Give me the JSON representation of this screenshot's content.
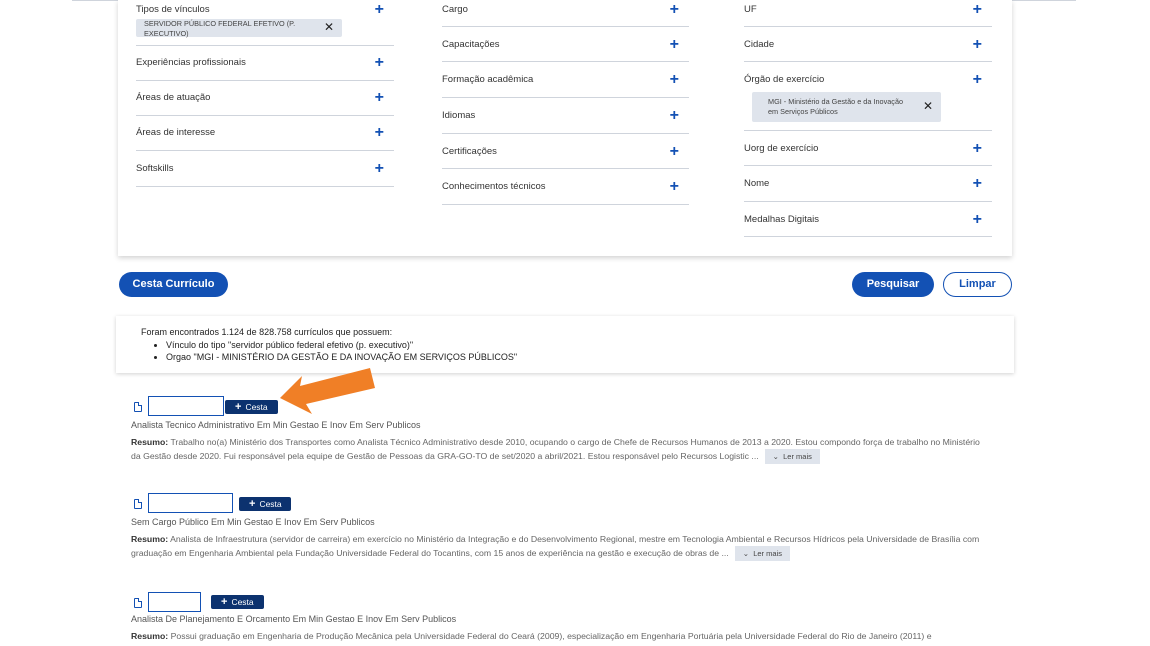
{
  "filters": {
    "col1": [
      {
        "label": "Tipos de vínculos",
        "chip": "SERVIDOR PÚBLICO FEDERAL EFETIVO (P. EXECUTIVO)"
      },
      {
        "label": "Experiências profissionais"
      },
      {
        "label": "Áreas de atuação"
      },
      {
        "label": "Áreas de interesse"
      },
      {
        "label": "Softskills"
      }
    ],
    "col2": [
      {
        "label": "Cargo"
      },
      {
        "label": "Capacitações"
      },
      {
        "label": "Formação acadêmica"
      },
      {
        "label": "Idiomas"
      },
      {
        "label": "Certificações"
      },
      {
        "label": "Conhecimentos técnicos"
      }
    ],
    "col3": [
      {
        "label": "UF"
      },
      {
        "label": "Cidade"
      },
      {
        "label": "Órgão de exercício",
        "chip": "MGI - Ministério da Gestão e da Inovação em Serviços Públicos"
      },
      {
        "label": "Uorg de exercício"
      },
      {
        "label": "Nome"
      },
      {
        "label": "Medalhas Digitais"
      }
    ]
  },
  "buttons": {
    "cesta_curriculo": "Cesta Currículo",
    "pesquisar": "Pesquisar",
    "limpar": "Limpar"
  },
  "summary": {
    "text": "Foram encontrados 1.124 de 828.758 currículos que possuem:",
    "items": [
      "Vínculo do tipo \"servidor público federal efetivo (p. executivo)\"",
      "Orgao \"MGI - MINISTÉRIO DA GESTÃO E DA INOVAÇÃO EM SERVIÇOS PÚBLICOS\""
    ]
  },
  "results": [
    {
      "cesta_label": "Cesta",
      "title": "Analista Tecnico Administrativo Em Min Gestao E Inov Em Serv Publicos",
      "resumo_label": "Resumo",
      "resumo": "Trabalho no(a) Ministério dos Transportes como Analista Técnico Administrativo desde 2010, ocupando o cargo de Chefe de Recursos Humanos de 2013 a 2020. Estou compondo força de trabalho no Ministério da Gestão desde 2020. Fui responsável pela equipe de Gestão de Pessoas da GRA-GO-TO de set/2020 a abril/2021. Estou responsável pelo Recursos Logistic ...",
      "ler_mais": "Ler mais"
    },
    {
      "cesta_label": "Cesta",
      "title": "Sem Cargo Público Em Min Gestao E Inov Em Serv Publicos",
      "resumo_label": "Resumo",
      "resumo": "Analista de Infraestrutura (servidor de carreira) em exercício no Ministério da Integração e do Desenvolvimento Regional, mestre em Tecnologia Ambiental e Recursos Hídricos pela Universidade de Brasília com graduação em Engenharia Ambiental pela Fundação Universidade Federal do Tocantins, com 15 anos de experiência na gestão e execução de obras de ...",
      "ler_mais": "Ler mais"
    },
    {
      "cesta_label": "Cesta",
      "title": "Analista De Planejamento E Orcamento Em Min Gestao E Inov Em Serv Publicos",
      "resumo_label": "Resumo",
      "resumo": "Possui graduação em Engenharia de Produção Mecânica pela Universidade Federal do Ceará (2009), especialização em Engenharia Portuária pela Universidade Federal do Rio de Janeiro (2011) e",
      "ler_mais": ""
    }
  ],
  "colors": {
    "primary": "#1351b4",
    "dark_button": "#0c326f",
    "annotation_arrow": "#f07f26",
    "chip_bg": "#dfe4ec"
  }
}
